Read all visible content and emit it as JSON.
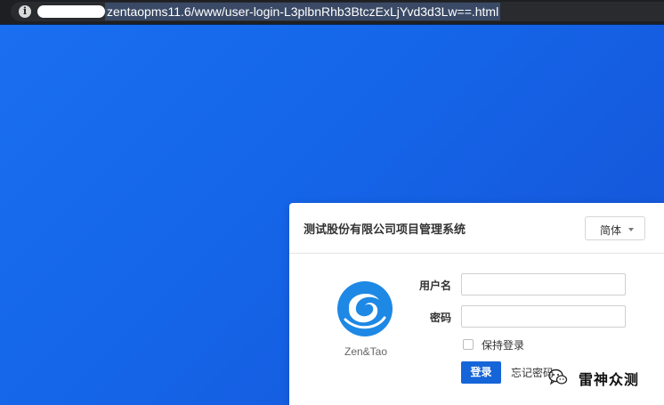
{
  "browser": {
    "url": "zentaopms11.6/www/user-login-L3plbnRhb3BtczExLjYvd3d3Lw==.html",
    "info_icon": "info-icon"
  },
  "login": {
    "title": "测试股份有限公司项目管理系统",
    "language": "简体",
    "logo_text": "Zen&Tao",
    "username_label": "用户名",
    "password_label": "密码",
    "username_value": "",
    "password_value": "",
    "keep_login_label": "保持登录",
    "keep_login_checked": false,
    "login_button": "登录",
    "forgot_password": "忘记密码"
  },
  "watermark": {
    "text": "雷神众测",
    "icon": "wechat-icon"
  },
  "colors": {
    "background_start": "#1a6ff0",
    "background_end": "#1552d6",
    "primary_button": "#1565d8",
    "logo_blue": "#1e88e5"
  }
}
